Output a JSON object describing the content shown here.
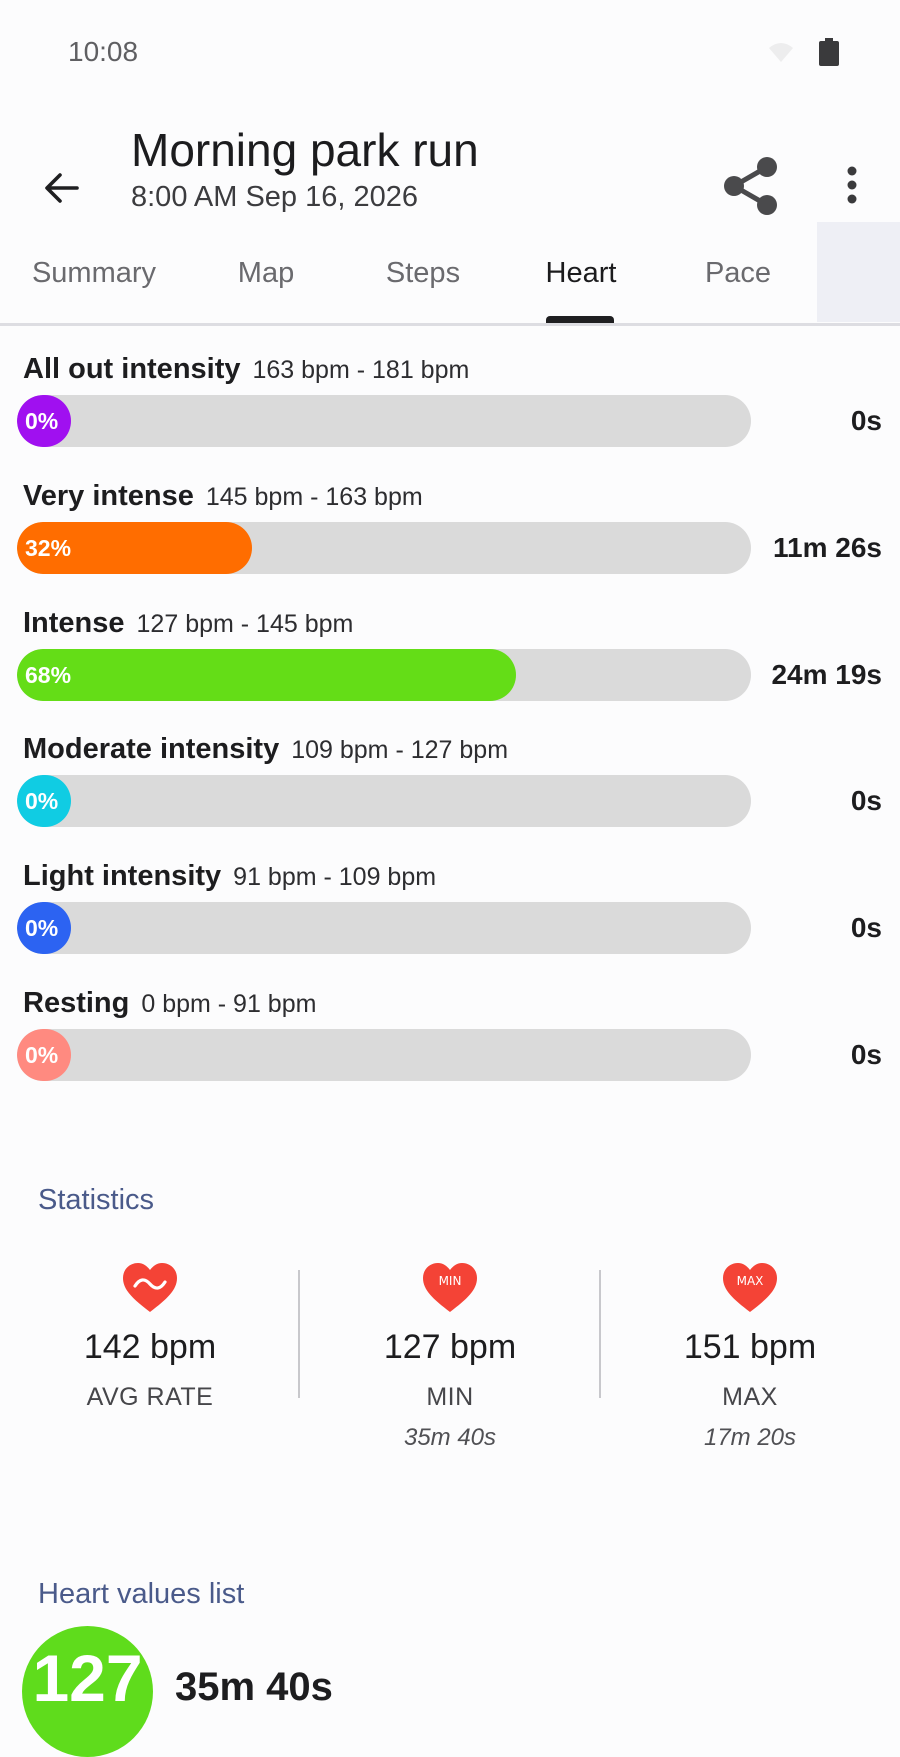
{
  "status_bar": {
    "time": "10:08"
  },
  "header": {
    "title": "Morning park run",
    "subtitle": "8:00 AM Sep 16, 2026"
  },
  "tabs": [
    {
      "label": "Summary",
      "active": false
    },
    {
      "label": "Map",
      "active": false
    },
    {
      "label": "Steps",
      "active": false
    },
    {
      "label": "Heart",
      "active": true
    },
    {
      "label": "Pace",
      "active": false
    }
  ],
  "zones": [
    {
      "name": "All out intensity",
      "range": "163 bpm - 181 bpm",
      "percent_label": "0%",
      "percent": 0,
      "duration": "0s",
      "color": "#a010f0"
    },
    {
      "name": "Very intense",
      "range": "145 bpm - 163 bpm",
      "percent_label": "32%",
      "percent": 32,
      "duration": "11m 26s",
      "color": "#ff6d00"
    },
    {
      "name": "Intense",
      "range": "127 bpm - 145 bpm",
      "percent_label": "68%",
      "percent": 68,
      "duration": "24m 19s",
      "color": "#64dd17"
    },
    {
      "name": "Moderate intensity",
      "range": "109 bpm - 127 bpm",
      "percent_label": "0%",
      "percent": 0,
      "duration": "0s",
      "color": "#10cce3"
    },
    {
      "name": "Light intensity",
      "range": "91 bpm - 109 bpm",
      "percent_label": "0%",
      "percent": 0,
      "duration": "0s",
      "color": "#2c63f2"
    },
    {
      "name": "Resting",
      "range": "0 bpm - 91 bpm",
      "percent_label": "0%",
      "percent": 0,
      "duration": "0s",
      "color": "#ff8a80"
    }
  ],
  "statistics": {
    "heading": "Statistics",
    "items": [
      {
        "icon": "heart-average-icon",
        "value": "142 bpm",
        "label": "AVG RATE",
        "sub": ""
      },
      {
        "icon": "heart-min-icon",
        "icon_text": "MIN",
        "value": "127 bpm",
        "label": "MIN",
        "sub": "35m 40s"
      },
      {
        "icon": "heart-max-icon",
        "icon_text": "MAX",
        "value": "151 bpm",
        "label": "MAX",
        "sub": "17m 20s"
      }
    ]
  },
  "heart_values": {
    "heading": "Heart values list",
    "items": [
      {
        "bpm": "127",
        "duration": "35m 40s",
        "color": "#5fdc1c"
      }
    ]
  },
  "colors": {
    "accent_heading": "#4a5a8a",
    "heart_icon": "#f44336",
    "track": "#dadada"
  }
}
